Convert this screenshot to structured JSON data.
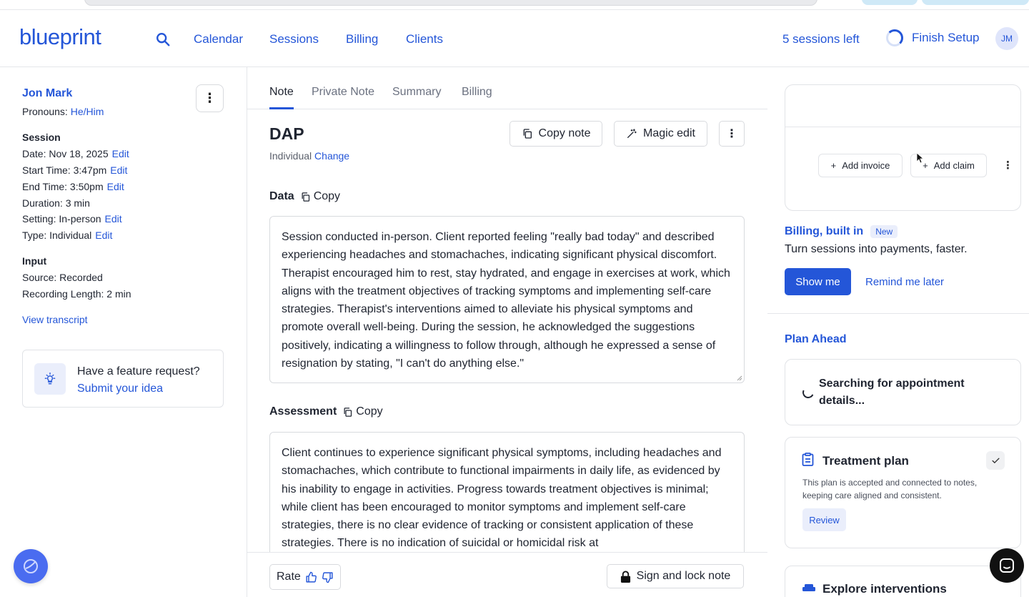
{
  "brand": {
    "logo_text": "blueprint",
    "accent": "#2456d8"
  },
  "nav": {
    "search_icon": "search-icon",
    "links": [
      "Calendar",
      "Sessions",
      "Billing",
      "Clients"
    ],
    "sessions_left": "5 sessions left",
    "finish_setup": "Finish Setup",
    "avatar_initials": "JM"
  },
  "client": {
    "name": "Jon Mark",
    "pronouns_label": "Pronouns:",
    "pronouns_value": "He/Him",
    "session_heading": "Session",
    "date": "Date: Nov 18, 2025",
    "start_time": "Start Time: 3:47pm",
    "end_time": "End Time: 3:50pm",
    "duration": "Duration: 3 min",
    "setting": "Setting: In-person",
    "type": "Type: Individual",
    "edit_label": "Edit",
    "input_heading": "Input",
    "source": "Source: Recorded",
    "recording_length": "Recording Length: 2 min",
    "view_transcript": "View transcript"
  },
  "feature": {
    "title": "Have a feature request?",
    "link": "Submit your idea"
  },
  "note": {
    "tabs": [
      "Note",
      "Private Note",
      "Summary",
      "Billing"
    ],
    "active_tab": "Note",
    "title": "DAP",
    "subtitle": "Individual",
    "change_label": "Change",
    "copy_note": "Copy note",
    "magic_edit": "Magic edit",
    "copy_label": "Copy",
    "sections": [
      {
        "label": "Data",
        "text": "Session conducted in-person. Client reported feeling \"really bad today\" and described experiencing headaches and stomachaches, indicating significant physical discomfort. Therapist encouraged him to rest, stay hydrated, and engage in exercises at work, which aligns with the treatment objectives of tracking symptoms and implementing self-care strategies. Therapist's interventions aimed to alleviate his physical symptoms and promote overall well-being. During the session, he acknowledged the suggestions positively, indicating a willingness to follow through, although he expressed a sense of resignation by stating, \"I can't do anything else.\""
      },
      {
        "label": "Assessment",
        "text": "Client continues to experience significant physical symptoms, including headaches and stomachaches, which contribute to functional impairments in daily life, as evidenced by his inability to engage in activities. Progress towards treatment objectives is minimal; while client has been encouraged to monitor symptoms and implement self-care strategies, there is no clear evidence of tracking or consistent application of these strategies. There is no indication of suicidal or homicidal risk at"
      }
    ],
    "rate_label": "Rate",
    "sign_lock": "Sign and lock note"
  },
  "right": {
    "add_invoice": "Add invoice",
    "add_claim": "Add claim",
    "billing_title": "Billing, built in",
    "new_badge": "New",
    "billing_desc": "Turn sessions into payments, faster.",
    "show_me": "Show me",
    "remind_later": "Remind me later",
    "plan_ahead": "Plan Ahead",
    "searching": "Searching for appointment details...",
    "treatment_plan": {
      "title": "Treatment plan",
      "desc": "This plan is accepted and connected to notes, keeping care aligned and consistent.",
      "review": "Review"
    },
    "explore": "Explore interventions"
  }
}
